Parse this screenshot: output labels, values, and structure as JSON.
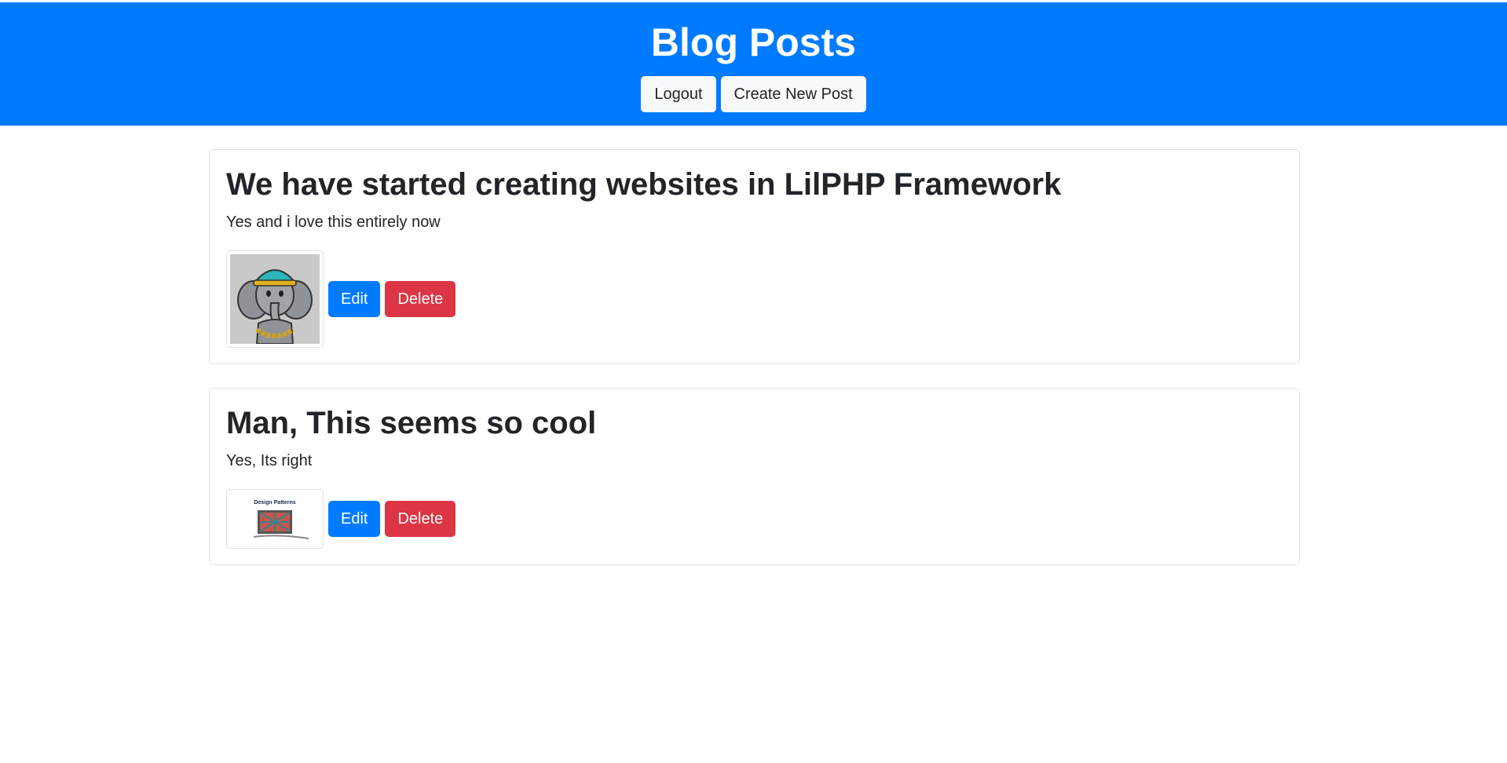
{
  "header": {
    "title": "Blog Posts",
    "logout_label": "Logout",
    "create_label": "Create New Post",
    "background_color": "#007bff"
  },
  "posts": [
    {
      "title": "We have started creating websites in LilPHP Framework",
      "body": "Yes and i love this entirely now",
      "image": "elephant-mascot-image",
      "edit_label": "Edit",
      "delete_label": "Delete"
    },
    {
      "title": "Man, This seems so cool",
      "body": "Yes, Its right",
      "image": "design-patterns-book-image",
      "image_caption": "Design Patterns",
      "edit_label": "Edit",
      "delete_label": "Delete"
    }
  ],
  "colors": {
    "primary": "#007bff",
    "danger": "#dc3545",
    "light": "#f8f9fa"
  }
}
